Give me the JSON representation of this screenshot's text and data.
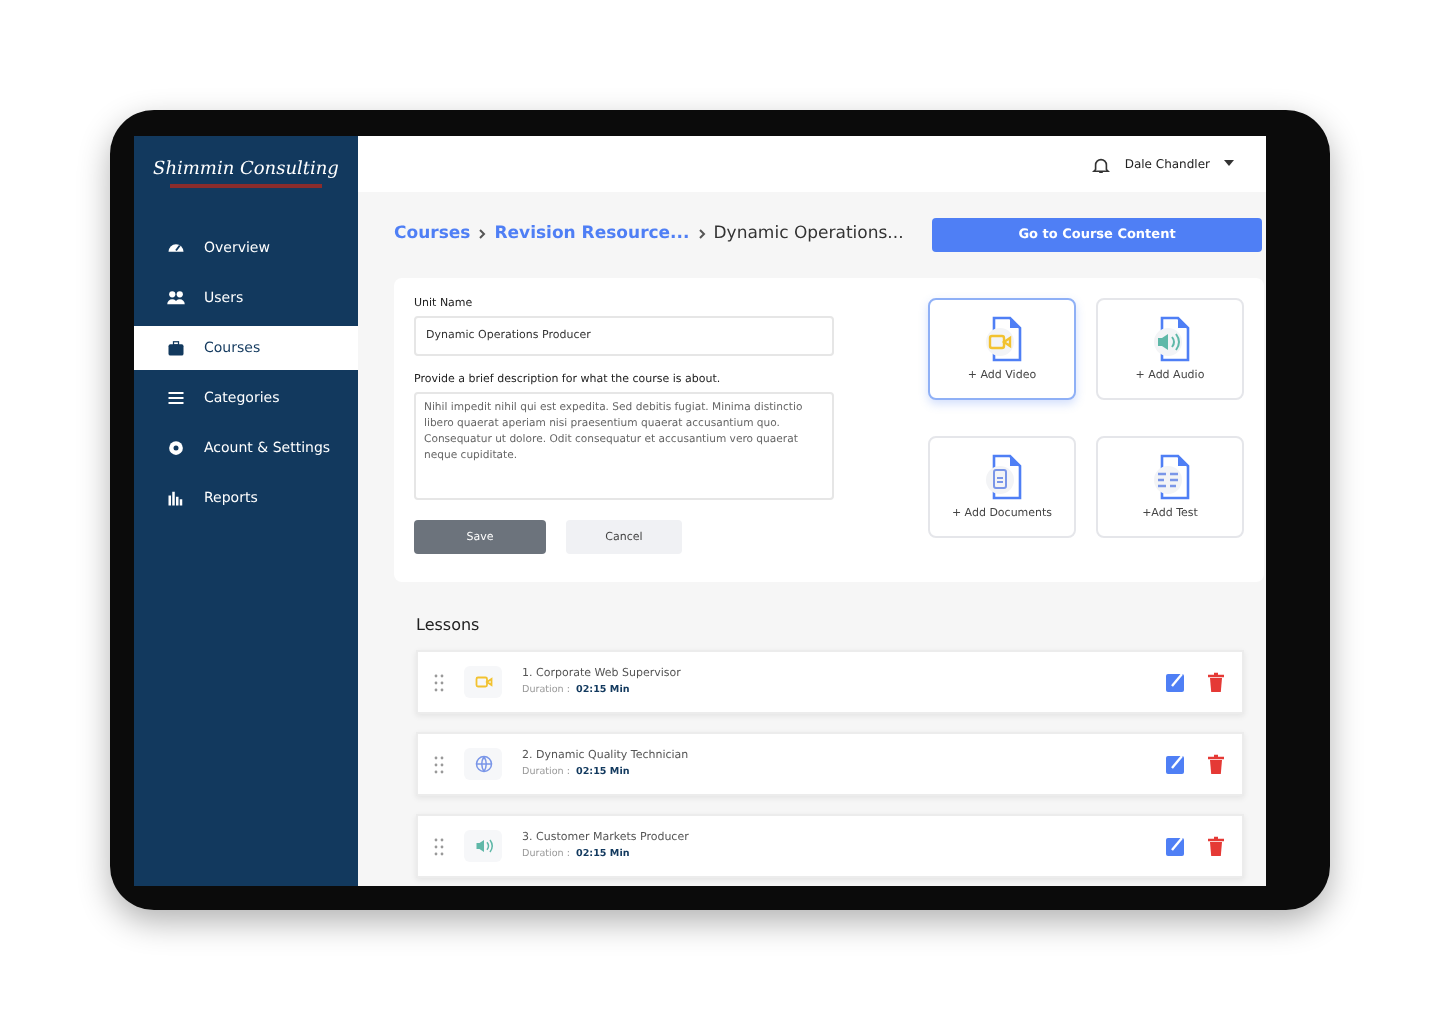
{
  "sidebar": {
    "logo": "Shimmin Consulting",
    "items": [
      {
        "label": "Overview",
        "kind": "gauge",
        "selected": false
      },
      {
        "label": "Users",
        "kind": "users",
        "selected": false
      },
      {
        "label": "Courses",
        "kind": "briefcase",
        "selected": true
      },
      {
        "label": "Categories",
        "kind": "list",
        "selected": false
      },
      {
        "label": "Acount & Settings",
        "kind": "gear",
        "selected": false
      },
      {
        "label": "Reports",
        "kind": "chart",
        "selected": false
      }
    ]
  },
  "topbar": {
    "user": "Dale Chandler"
  },
  "breadcrumb": [
    "Courses",
    "Revision Resource...",
    "Dynamic Operations..."
  ],
  "primary_button": "Go to Course Content",
  "form": {
    "unit_name_label": "Unit Name",
    "unit_name": "Dynamic Operations Producer",
    "description_label": "Provide a brief description for what the course is about.",
    "description": "Nihil impedit nihil qui est expedita. Sed debitis fugiat. Minima distinctio libero quaerat aperiam nisi praesentium quaerat accusantium quo. Consequatur ut dolore. Odit consequatur et accusantium vero quaerat neque cupiditate.",
    "save": "Save",
    "cancel": "Cancel"
  },
  "add_tiles": [
    {
      "label": "+ Add Video",
      "kind": "video",
      "selected": true
    },
    {
      "label": "+ Add Audio",
      "kind": "audio",
      "selected": false
    },
    {
      "label": "+ Add Documents",
      "kind": "document",
      "selected": false
    },
    {
      "label": "+Add Test",
      "kind": "test",
      "selected": false
    }
  ],
  "lessons": {
    "title": "Lessons",
    "items": [
      {
        "title": "1. Corporate Web Supervisor",
        "duration_label": "Duration :",
        "duration": "02:15 Min",
        "kind": "video"
      },
      {
        "title": "2. Dynamic Quality Technician",
        "duration_label": "Duration :",
        "duration": "02:15 Min",
        "kind": "web"
      },
      {
        "title": "3. Customer Markets Producer",
        "duration_label": "Duration :",
        "duration": "02:15 Min",
        "kind": "audio"
      }
    ]
  }
}
